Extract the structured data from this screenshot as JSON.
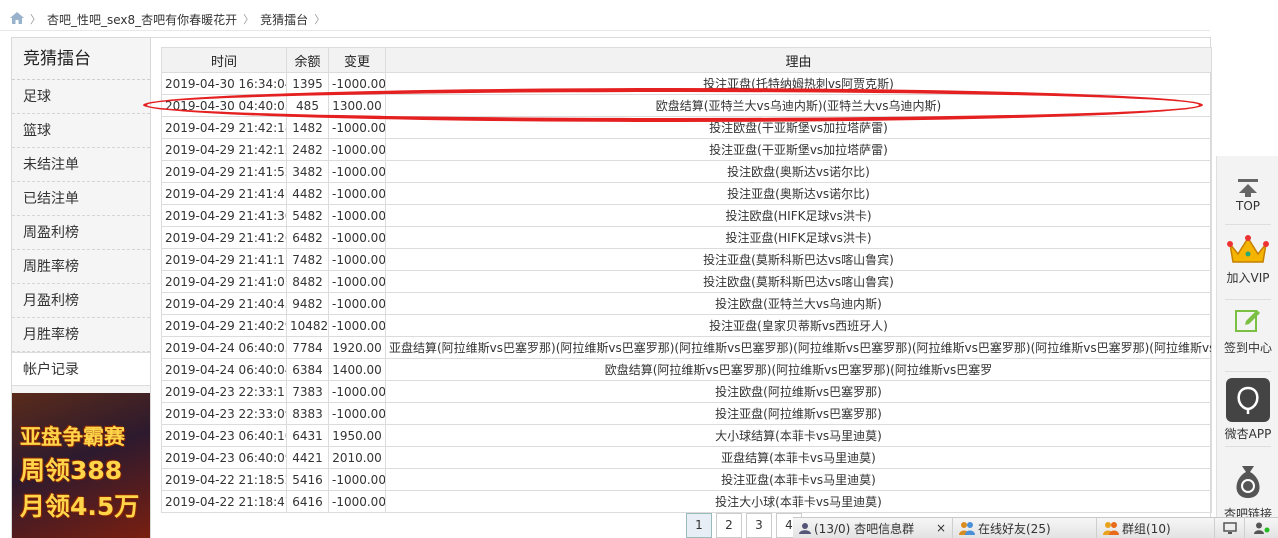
{
  "breadcrumb": {
    "home_icon": "home-icon",
    "items": [
      "杏吧_性吧_sex8_杏吧有你春暖花开",
      "竞猜擂台"
    ]
  },
  "sidebar": {
    "title": "竞猜擂台",
    "items": [
      "足球",
      "篮球",
      "未结注单",
      "已结注单",
      "周盈利榜",
      "周胜率榜",
      "月盈利榜",
      "月胜率榜",
      "帐户记录"
    ],
    "active_index": 8
  },
  "banner": {
    "line1": "亚盘争霸赛",
    "line2": "周领388",
    "line3": "月领4.5万"
  },
  "table": {
    "headers": [
      "时间",
      "余额",
      "变更",
      "理由"
    ],
    "rows": [
      [
        "2019-04-30 16:34:04",
        "1395",
        "-1000.00",
        "投注亚盘(托特纳姆热刺vs阿贾克斯)"
      ],
      [
        "2019-04-30 04:40:05",
        "485",
        "1300.00",
        "欧盘结算(亚特兰大vs乌迪内斯)(亚特兰大vs乌迪内斯)"
      ],
      [
        "2019-04-29 21:42:18",
        "1482",
        "-1000.00",
        "投注欧盘(干亚斯堡vs加拉塔萨雷)"
      ],
      [
        "2019-04-29 21:42:12",
        "2482",
        "-1000.00",
        "投注亚盘(干亚斯堡vs加拉塔萨雷)"
      ],
      [
        "2019-04-29 21:41:52",
        "3482",
        "-1000.00",
        "投注欧盘(奥斯达vs诺尔比)"
      ],
      [
        "2019-04-29 21:41:47",
        "4482",
        "-1000.00",
        "投注亚盘(奥斯达vs诺尔比)"
      ],
      [
        "2019-04-29 21:41:30",
        "5482",
        "-1000.00",
        "投注欧盘(HIFK足球vs洪卡)"
      ],
      [
        "2019-04-29 21:41:26",
        "6482",
        "-1000.00",
        "投注亚盘(HIFK足球vs洪卡)"
      ],
      [
        "2019-04-29 21:41:11",
        "7482",
        "-1000.00",
        "投注亚盘(莫斯科斯巴达vs喀山鲁宾)"
      ],
      [
        "2019-04-29 21:41:07",
        "8482",
        "-1000.00",
        "投注欧盘(莫斯科斯巴达vs喀山鲁宾)"
      ],
      [
        "2019-04-29 21:40:45",
        "9482",
        "-1000.00",
        "投注欧盘(亚特兰大vs乌迪内斯)"
      ],
      [
        "2019-04-29 21:40:29",
        "10482",
        "-1000.00",
        "投注亚盘(皇家贝蒂斯vs西班牙人)"
      ],
      [
        "2019-04-24 06:40:05",
        "7784",
        "1920.00",
        "亚盘结算(阿拉维斯vs巴塞罗那)(阿拉维斯vs巴塞罗那)(阿拉维斯vs巴塞罗那)(阿拉维斯vs巴塞罗那)(阿拉维斯vs巴塞罗那)(阿拉维斯vs巴塞罗那)(阿拉维斯vs"
      ],
      [
        "2019-04-24 06:40:04",
        "6384",
        "1400.00",
        "欧盘结算(阿拉维斯vs巴塞罗那)(阿拉维斯vs巴塞罗那)(阿拉维斯vs巴塞罗"
      ],
      [
        "2019-04-23 22:33:17",
        "7383",
        "-1000.00",
        "投注欧盘(阿拉维斯vs巴塞罗那)"
      ],
      [
        "2019-04-23 22:33:09",
        "8383",
        "-1000.00",
        "投注亚盘(阿拉维斯vs巴塞罗那)"
      ],
      [
        "2019-04-23 06:40:10",
        "6431",
        "1950.00",
        "大小球结算(本菲卡vs马里迪莫)"
      ],
      [
        "2019-04-23 06:40:09",
        "4421",
        "2010.00",
        "亚盘结算(本菲卡vs马里迪莫)"
      ],
      [
        "2019-04-22 21:18:52",
        "5416",
        "-1000.00",
        "投注亚盘(本菲卡vs马里迪莫)"
      ],
      [
        "2019-04-22 21:18:47",
        "6416",
        "-1000.00",
        "投注大小球(本菲卡vs马里迪莫)"
      ]
    ]
  },
  "right_toolbar": {
    "top_label": "TOP",
    "vip_label": "加入VIP",
    "checkin_label": "签到中心",
    "app_label": "微杏APP",
    "fifth_label": "杏吧链接"
  },
  "pager": {
    "pages": [
      "1",
      "2",
      "3",
      "4"
    ],
    "current": "1"
  },
  "chatbar": {
    "group_label": "(13/0) 杏吧信息群",
    "close_glyph": "×",
    "friends_label": "在线好友(25)",
    "groups_label": "群组(10)"
  },
  "colors": {
    "annotation_red": "#e52020",
    "sidebar_bg": "#f5f5f5",
    "header_bg": "#f2f2f2"
  }
}
